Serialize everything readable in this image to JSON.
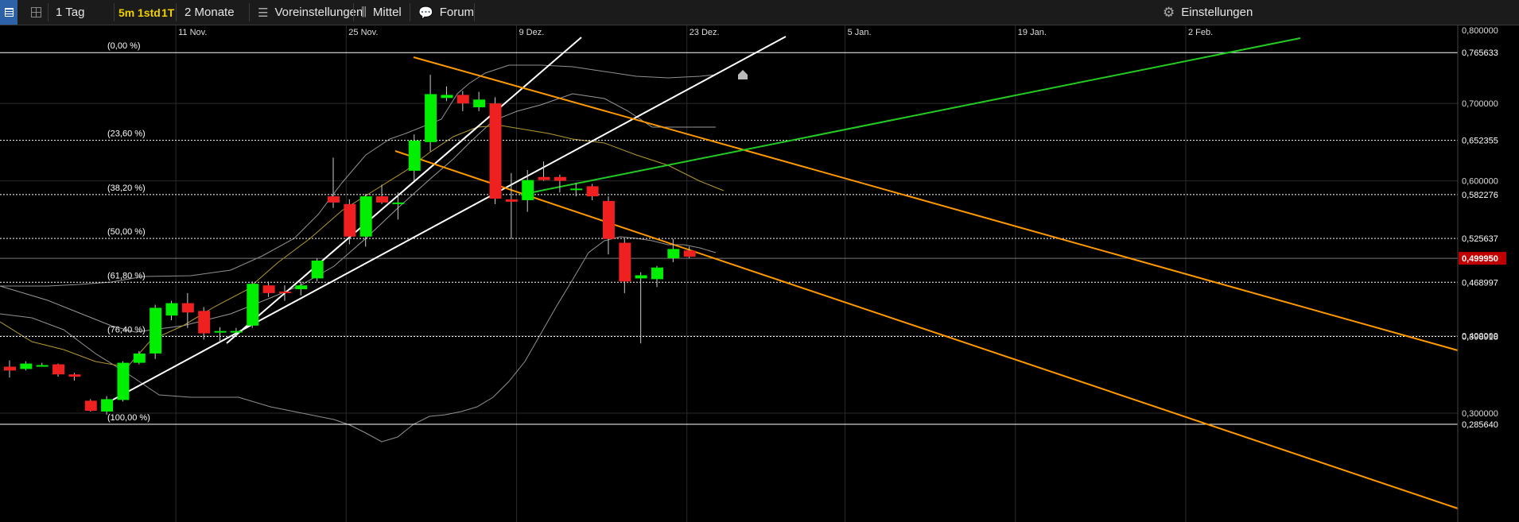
{
  "toolbar": {
    "period": "1 Tag",
    "tf_5m": "5m",
    "tf_1std": "1std",
    "tf_1t": "1T",
    "range": "2 Monate",
    "presets": "Voreinstellungen",
    "indicator": "Mittel",
    "forum": "Forum",
    "settings": "Einstellungen"
  },
  "chart_data": {
    "type": "candlestick",
    "x_ticks": [
      "11 Nov.",
      "25 Nov.",
      "9 Dez.",
      "23 Dez.",
      "5 Jan.",
      "19 Jan.",
      "2 Feb."
    ],
    "y_ticks": [
      "0,700000",
      "0,600000",
      "0,400000",
      "0,300000"
    ],
    "y_top_partial": "0,800000",
    "last_price": "0,499950",
    "last_price_value": 0.49995,
    "candles": [
      {
        "o": 0.36,
        "h": 0.368,
        "l": 0.346,
        "c": 0.355
      },
      {
        "o": 0.357,
        "h": 0.367,
        "l": 0.355,
        "c": 0.364
      },
      {
        "o": 0.362,
        "h": 0.365,
        "l": 0.36,
        "c": 0.362
      },
      {
        "o": 0.363,
        "h": 0.364,
        "l": 0.347,
        "c": 0.35
      },
      {
        "o": 0.35,
        "h": 0.352,
        "l": 0.342,
        "c": 0.347
      },
      {
        "o": 0.316,
        "h": 0.318,
        "l": 0.302,
        "c": 0.303
      },
      {
        "o": 0.302,
        "h": 0.322,
        "l": 0.298,
        "c": 0.318
      },
      {
        "o": 0.317,
        "h": 0.367,
        "l": 0.315,
        "c": 0.365
      },
      {
        "o": 0.365,
        "h": 0.38,
        "l": 0.363,
        "c": 0.377
      },
      {
        "o": 0.377,
        "h": 0.44,
        "l": 0.37,
        "c": 0.436
      },
      {
        "o": 0.426,
        "h": 0.445,
        "l": 0.42,
        "c": 0.442
      },
      {
        "o": 0.442,
        "h": 0.455,
        "l": 0.41,
        "c": 0.43
      },
      {
        "o": 0.432,
        "h": 0.437,
        "l": 0.395,
        "c": 0.403
      },
      {
        "o": 0.406,
        "h": 0.411,
        "l": 0.392,
        "c": 0.406
      },
      {
        "o": 0.406,
        "h": 0.41,
        "l": 0.4,
        "c": 0.406
      },
      {
        "o": 0.413,
        "h": 0.47,
        "l": 0.41,
        "c": 0.467
      },
      {
        "o": 0.465,
        "h": 0.47,
        "l": 0.45,
        "c": 0.455
      },
      {
        "o": 0.457,
        "h": 0.465,
        "l": 0.445,
        "c": 0.455
      },
      {
        "o": 0.46,
        "h": 0.47,
        "l": 0.452,
        "c": 0.465
      },
      {
        "o": 0.474,
        "h": 0.5,
        "l": 0.47,
        "c": 0.497
      },
      {
        "o": 0.58,
        "h": 0.63,
        "l": 0.565,
        "c": 0.572
      },
      {
        "o": 0.57,
        "h": 0.576,
        "l": 0.518,
        "c": 0.528
      },
      {
        "o": 0.528,
        "h": 0.583,
        "l": 0.515,
        "c": 0.58
      },
      {
        "o": 0.58,
        "h": 0.595,
        "l": 0.57,
        "c": 0.572
      },
      {
        "o": 0.57,
        "h": 0.585,
        "l": 0.55,
        "c": 0.572
      },
      {
        "o": 0.613,
        "h": 0.66,
        "l": 0.6,
        "c": 0.652
      },
      {
        "o": 0.65,
        "h": 0.737,
        "l": 0.638,
        "c": 0.712
      },
      {
        "o": 0.707,
        "h": 0.722,
        "l": 0.703,
        "c": 0.711
      },
      {
        "o": 0.711,
        "h": 0.716,
        "l": 0.69,
        "c": 0.7
      },
      {
        "o": 0.695,
        "h": 0.715,
        "l": 0.69,
        "c": 0.705
      },
      {
        "o": 0.7,
        "h": 0.708,
        "l": 0.57,
        "c": 0.577
      },
      {
        "o": 0.576,
        "h": 0.61,
        "l": 0.525,
        "c": 0.573
      },
      {
        "o": 0.575,
        "h": 0.614,
        "l": 0.56,
        "c": 0.601
      },
      {
        "o": 0.605,
        "h": 0.625,
        "l": 0.6,
        "c": 0.601
      },
      {
        "o": 0.605,
        "h": 0.608,
        "l": 0.585,
        "c": 0.6
      },
      {
        "o": 0.59,
        "h": 0.597,
        "l": 0.58,
        "c": 0.59
      },
      {
        "o": 0.593,
        "h": 0.596,
        "l": 0.575,
        "c": 0.58
      },
      {
        "o": 0.574,
        "h": 0.58,
        "l": 0.505,
        "c": 0.525
      },
      {
        "o": 0.52,
        "h": 0.525,
        "l": 0.455,
        "c": 0.47
      },
      {
        "o": 0.474,
        "h": 0.482,
        "l": 0.39,
        "c": 0.478
      },
      {
        "o": 0.473,
        "h": 0.49,
        "l": 0.463,
        "c": 0.488
      },
      {
        "o": 0.5,
        "h": 0.525,
        "l": 0.495,
        "c": 0.512
      },
      {
        "o": 0.51,
        "h": 0.515,
        "l": 0.5,
        "c": 0.502
      }
    ],
    "fibonacci": [
      {
        "label": "(0,00 %)",
        "value": 0.765633,
        "price_label": "0,765633",
        "style": "solid"
      },
      {
        "label": "(23,60 %)",
        "value": 0.652355,
        "price_label": "0,652355",
        "style": "dotted"
      },
      {
        "label": "(38,20 %)",
        "value": 0.582276,
        "price_label": "0,582276",
        "style": "dotted"
      },
      {
        "label": "(50,00 %)",
        "value": 0.525637,
        "price_label": "0,525637",
        "style": "dotted"
      },
      {
        "label": "(61,80 %)",
        "value": 0.468997,
        "price_label": "0,468997",
        "style": "dotted"
      },
      {
        "label": "(76,40 %)",
        "value": 0.398918,
        "price_label": "0,398918",
        "style": "dotted"
      },
      {
        "label": "(100,00 %)",
        "value": 0.28564,
        "price_label": "0,285640",
        "style": "solid"
      }
    ],
    "colors": {
      "up": "#00ee00",
      "down": "#ee2020",
      "trend_white": "#ffffff",
      "trend_orange": "#ff9900",
      "trend_green": "#22cc22",
      "bollinger": "#aaaaaa",
      "moving_average": "#b59a30",
      "last_price_bg": "#c00000",
      "axis_text": "#dddddd",
      "background": "#000000"
    }
  }
}
